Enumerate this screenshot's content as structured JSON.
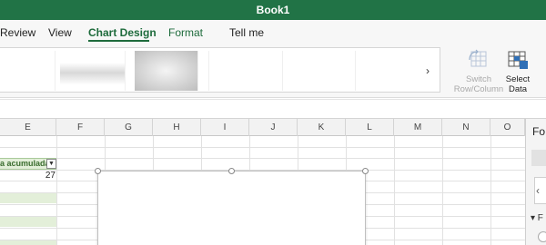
{
  "app": {
    "title": "Book1"
  },
  "tabs": [
    {
      "label": "Review"
    },
    {
      "label": "View"
    },
    {
      "label": "Chart Design",
      "active": true
    },
    {
      "label": "Format"
    }
  ],
  "tell_me": {
    "label": "Tell me"
  },
  "ribbon": {
    "gallery_next_label": "›",
    "switch_row_column": {
      "line1": "Switch",
      "line2": "Row/Column",
      "enabled": false
    },
    "select_data": {
      "line1": "Select",
      "line2": "Data",
      "enabled": true
    }
  },
  "grid": {
    "columns": [
      "E",
      "F",
      "G",
      "H",
      "I",
      "J",
      "K",
      "L",
      "M",
      "N",
      "O"
    ],
    "header_cell": "a acumulada",
    "filter_label": "▼",
    "first_value": "27"
  },
  "pane": {
    "title": "Fo",
    "nav_label": "‹",
    "section_label": "▾ F"
  },
  "colors": {
    "accent": "#217346",
    "tab_active": "#1e6b3c",
    "band": "#e3efd9"
  }
}
